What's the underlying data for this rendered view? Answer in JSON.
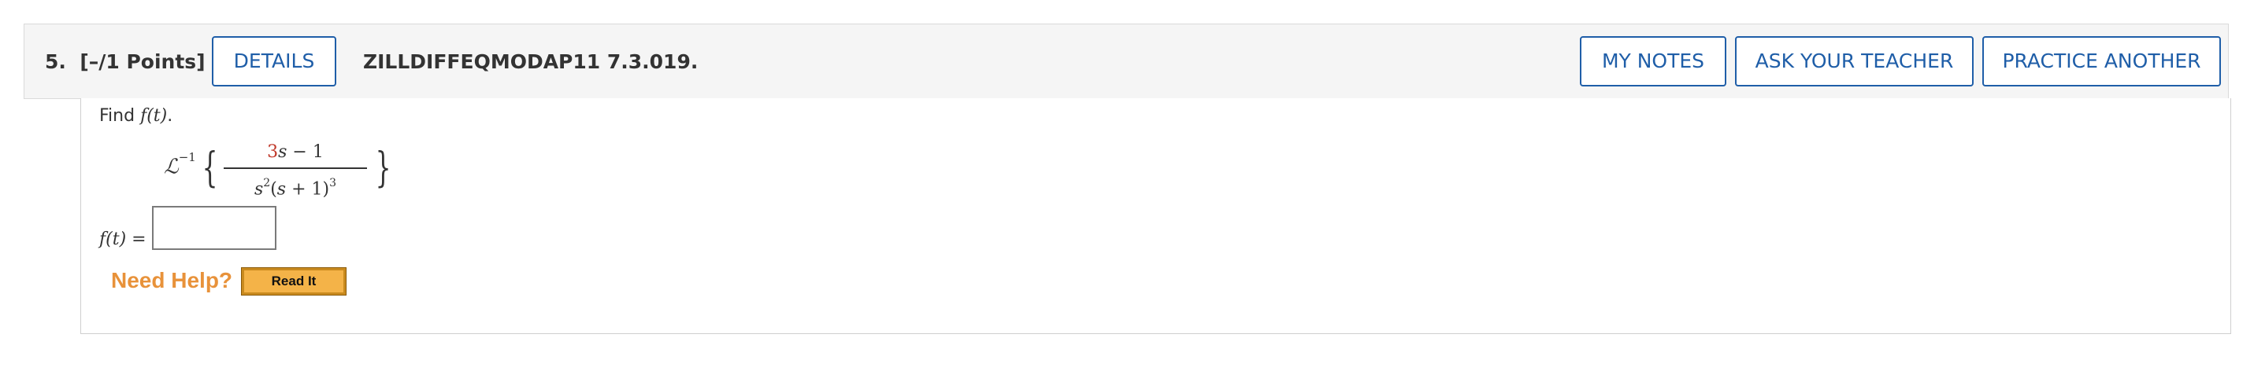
{
  "question": {
    "number": "5.",
    "points": "[–/1 Points]",
    "code": "ZILLDIFFEQMODAP11 7.3.019."
  },
  "buttons": {
    "details": "DETAILS",
    "my_notes": "MY NOTES",
    "ask_teacher": "ASK YOUR TEACHER",
    "practice_another": "PRACTICE ANOTHER"
  },
  "body": {
    "prompt_prefix": "Find ",
    "prompt_fn": "f(t)",
    "prompt_suffix": ".",
    "laplace_symbol": "ℒ",
    "laplace_exp": "−1",
    "brace_left": "{",
    "brace_right": "}",
    "numerator_coef": "3",
    "numerator_var": "s",
    "numerator_rest": " − 1",
    "denominator_s": "s",
    "denominator_s_exp": "2",
    "denominator_open": "(",
    "denominator_var": "s",
    "denominator_mid": " + 1)",
    "denominator_exp": "3",
    "answer_fn": "f(t)",
    "answer_eq": " =",
    "answer_value": ""
  },
  "help": {
    "label": "Need Help?",
    "read_it": "Read It"
  },
  "colors": {
    "accent_blue": "#1f5ea8",
    "need_help_orange": "#e8923a",
    "read_it_bg": "#f4b348",
    "numerator_red": "#c0392b"
  }
}
